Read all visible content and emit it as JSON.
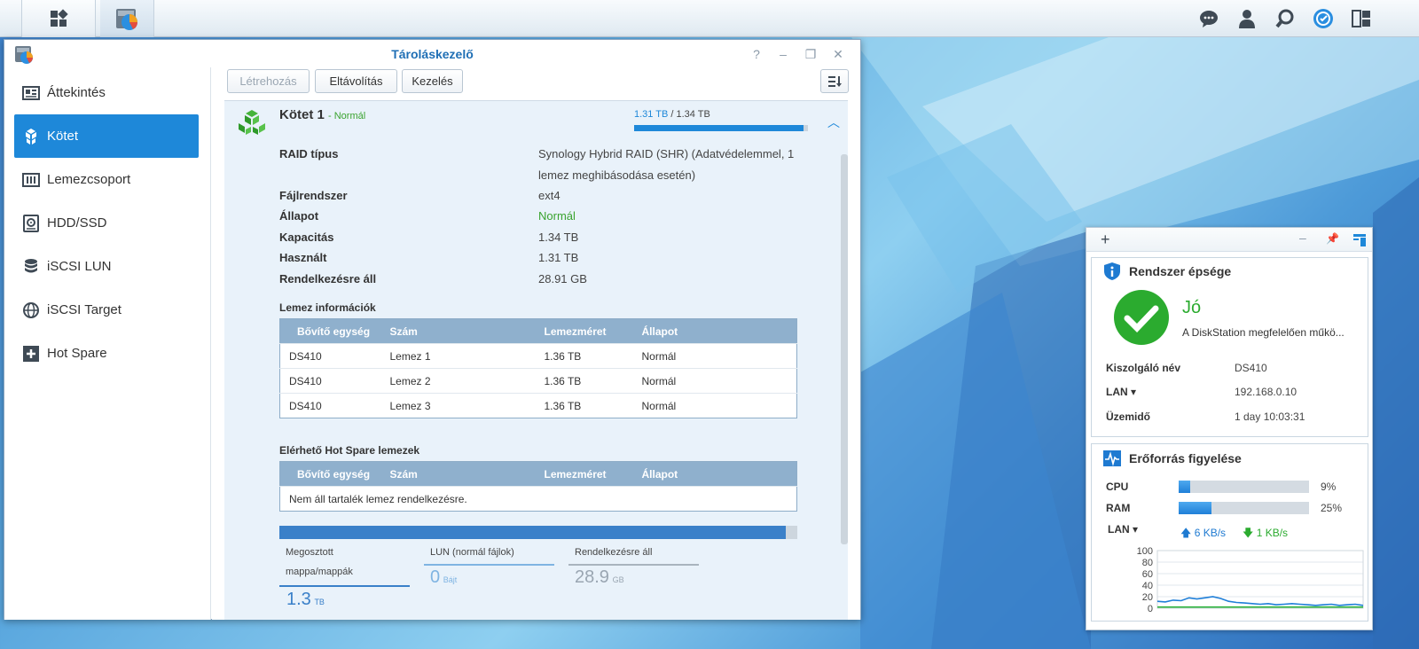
{
  "window": {
    "title": "Tároláskezelő"
  },
  "sidebar": {
    "items": [
      {
        "label": "Áttekintés"
      },
      {
        "label": "Kötet"
      },
      {
        "label": "Lemezcsoport"
      },
      {
        "label": "HDD/SSD"
      },
      {
        "label": "iSCSI LUN"
      },
      {
        "label": "iSCSI Target"
      },
      {
        "label": "Hot Spare"
      }
    ]
  },
  "toolbar": {
    "create": "Létrehozás",
    "remove": "Eltávolítás",
    "manage": "Kezelés"
  },
  "volume": {
    "name": "Kötet 1",
    "status_suffix": "- Normál",
    "used_text": "1.31 TB",
    "total_text": "/ 1.34 TB",
    "usage_fraction": 0.977,
    "rows": [
      {
        "label": "RAID típus",
        "value": "Synology Hybrid RAID (SHR) (Adatvédelemmel, 1",
        "value2": "lemez meghibásodása esetén)"
      },
      {
        "label": "Fájlrendszer",
        "value": "ext4"
      },
      {
        "label": "Állapot",
        "value": "Normál"
      },
      {
        "label": "Kapacitás",
        "value": "1.34 TB"
      },
      {
        "label": "Használt",
        "value": "1.31 TB"
      },
      {
        "label": "Rendelkezésre áll",
        "value": "28.91 GB"
      }
    ]
  },
  "disk_info": {
    "title": "Lemez információk",
    "headers": [
      "Bővítő egység",
      "Szám",
      "Lemezméret",
      "Állapot"
    ],
    "rows": [
      [
        "DS410",
        "Lemez 1",
        "1.36 TB",
        "Normál"
      ],
      [
        "DS410",
        "Lemez 2",
        "1.36 TB",
        "Normál"
      ],
      [
        "DS410",
        "Lemez 3",
        "1.36 TB",
        "Normál"
      ]
    ]
  },
  "hot_spare": {
    "title": "Elérhető Hot Spare lemezek",
    "headers": [
      "Bővítő egység",
      "Szám",
      "Lemezméret",
      "Állapot"
    ],
    "empty": "Nem áll tartalék lemez rendelkezésre."
  },
  "usage": {
    "shared_label_1": "Megosztott",
    "shared_label_2": "mappa/mappák",
    "shared_value": "1.3",
    "shared_unit": "TB",
    "lun_label": "LUN (normál fájlok)",
    "lun_value": "0",
    "lun_unit": "Bájt",
    "avail_label": "Rendelkezésre áll",
    "avail_value": "28.9",
    "avail_unit": "GB",
    "bar_fraction": 0.978
  },
  "health": {
    "title": "Rendszer épsége",
    "status": "Jó",
    "message": "A DiskStation megfelelően műkö...",
    "server_label": "Kiszolgáló név",
    "server_value": "DS410",
    "lan_label": "LAN",
    "lan_value": "192.168.0.10",
    "uptime_label": "Üzemidő",
    "uptime_value": "1 day 10:03:31"
  },
  "resource": {
    "title": "Erőforrás figyelése",
    "cpu_label": "CPU",
    "cpu_value": "9%",
    "cpu_fraction": 0.09,
    "ram_label": "RAM",
    "ram_value": "25%",
    "ram_fraction": 0.25,
    "lan_label": "LAN",
    "up_value": "6 KB/s",
    "down_value": "1 KB/s",
    "graph_ticks": [
      "100",
      "80",
      "60",
      "40",
      "20",
      "0"
    ],
    "upload_series": [
      12,
      11,
      14,
      13,
      18,
      16,
      18,
      20,
      17,
      12,
      10,
      9,
      8,
      7,
      8,
      6,
      7,
      8,
      7,
      6,
      5,
      6,
      7,
      5,
      6,
      7,
      5
    ],
    "download_series": [
      2,
      2,
      2,
      2,
      2,
      2,
      2,
      2,
      2,
      2,
      2,
      2,
      2,
      2,
      2,
      2,
      2,
      2,
      2,
      2,
      2,
      2,
      2,
      2,
      2,
      2,
      2
    ]
  },
  "colors": {
    "accent": "#1e88d9",
    "ok_green": "#39a32e",
    "upload": "#1f7fd8",
    "download": "#2bb33a"
  }
}
